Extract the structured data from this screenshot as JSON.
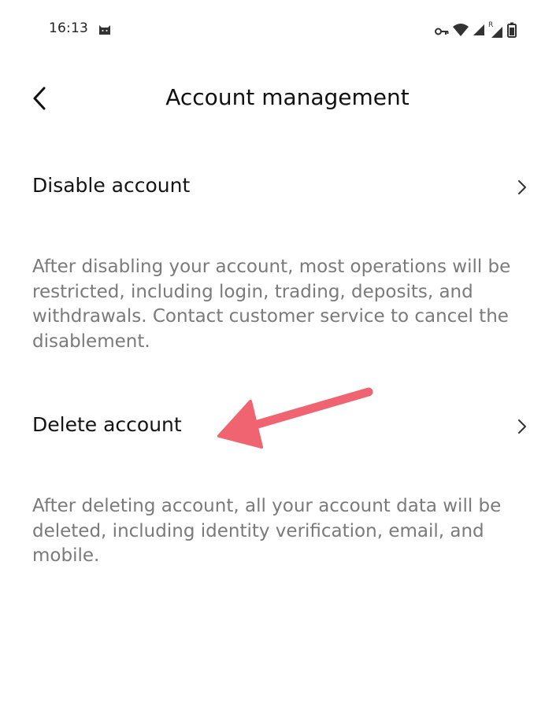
{
  "status_bar": {
    "time": "16:13",
    "icons": [
      "cat-icon",
      "key-icon",
      "wifi-icon",
      "signal-icon",
      "roaming-signal-icon",
      "battery-icon"
    ],
    "roaming_mark": "R"
  },
  "header": {
    "title": "Account management",
    "back_icon": "chevron-left-icon"
  },
  "items": [
    {
      "label": "Disable account",
      "description": "After disabling your account, most operations will be restricted, including login, trading, deposits, and withdrawals. Contact customer service to cancel the disablement."
    },
    {
      "label": "Delete account",
      "description": "After deleting account, all your account data will be deleted, including identity verification, email, and mobile."
    }
  ],
  "colors": {
    "background": "#ffffff",
    "text_primary": "#141414",
    "text_secondary": "#7a7a7a",
    "annotation_arrow": "#ef6470"
  }
}
